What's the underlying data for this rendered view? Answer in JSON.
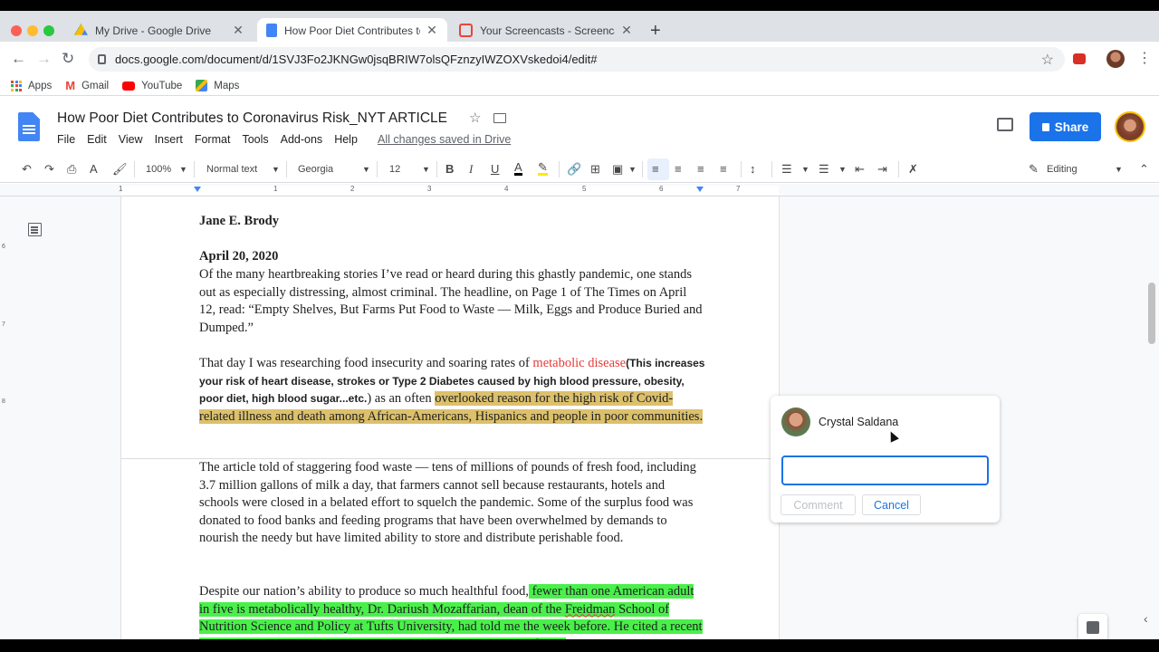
{
  "browser": {
    "tabs": [
      {
        "title": "My Drive - Google Drive",
        "close": "✕",
        "active": false
      },
      {
        "title": "How Poor Diet Contributes to Co",
        "close": "✕",
        "active": true
      },
      {
        "title": "Your Screencasts - Screencastif",
        "close": "✕",
        "active": false
      }
    ],
    "new_tab": "+",
    "url": "docs.google.com/document/d/1SVJ3Fo2JKNGw0jsqBRIW7olsQFznzyIWZOXVskedoi4/edit#",
    "bookmarks": [
      {
        "label": "Apps",
        "icon": "apps-grid-icon"
      },
      {
        "label": "Gmail",
        "icon": "gmail-icon"
      },
      {
        "label": "YouTube",
        "icon": "youtube-icon"
      },
      {
        "label": "Maps",
        "icon": "maps-icon"
      }
    ]
  },
  "docs": {
    "title": "How Poor Diet Contributes to Coronavirus Risk_NYT ARTICLE",
    "menus": [
      "File",
      "Edit",
      "View",
      "Insert",
      "Format",
      "Tools",
      "Add-ons",
      "Help"
    ],
    "saved_status": "All changes saved in Drive",
    "share_label": "Share",
    "toolbar": {
      "zoom": "100%",
      "style": "Normal text",
      "font": "Georgia",
      "size": "12",
      "mode": "Editing"
    },
    "ruler_numbers": [
      "1",
      "1",
      "2",
      "3",
      "4",
      "5",
      "6",
      "7"
    ],
    "vertical_ruler": [
      "6",
      "7",
      "8"
    ]
  },
  "document": {
    "author": "Jane E. Brody",
    "date": "April 20, 2020",
    "p1": "Of the many heartbreaking stories I’ve read or heard during this ghastly pandemic, one stands out as especially distressing, almost criminal. The headline, on Page 1 of The Times on April 12, read: “Empty Shelves, But Farms Put Food to Waste — Milk, Eggs and Produce Buried and Dumped.”",
    "p2_start": "That day I was researching food insecurity and soaring rates of ",
    "p2_link": "metabolic disease",
    "p2_note": "(This increases your risk of heart disease, strokes or Type 2 Diabetes caused by high blood pressure, obesity, poor diet, high blood sugar...etc.",
    "p2_mid": ") as an often ",
    "p2_highlight": "overlooked reason for the high risk of Covid-related illness and death among African-Americans, Hispanics and people in poor communities.",
    "p3": "The article told of staggering food waste — tens of millions of pounds of fresh food, including 3.7 million gallons of milk a day, that farmers cannot sell because restaurants, hotels and schools were closed in a belated effort to squelch the pandemic. Some of the surplus food was donated to food banks and feeding programs that have been overwhelmed by demands to nourish the needy but have limited ability to store and distribute perishable food.",
    "p4_start": "Despite our nation’s ability to produce so much healthful food,",
    "p4_hl1": " fewer than one American adult in five is metabolically healthy, Dr. Dariush Mozaffarian, dean of the ",
    "p4_hl_squiggle": "Freidman",
    "p4_hl2": " School of Nutrition Science and Policy at Tufts University, had told me the week before. He cited a recent national report describing poor diet as “now the leading cause of poor"
  },
  "comment": {
    "user": "Crystal Saldana",
    "input_value": "",
    "comment_label": "Comment",
    "cancel_label": "Cancel"
  },
  "colors": {
    "share_blue": "#1a73e8",
    "highlight_gold": "#dcc06b",
    "highlight_green": "#4af04a",
    "link_red": "#e53935"
  }
}
